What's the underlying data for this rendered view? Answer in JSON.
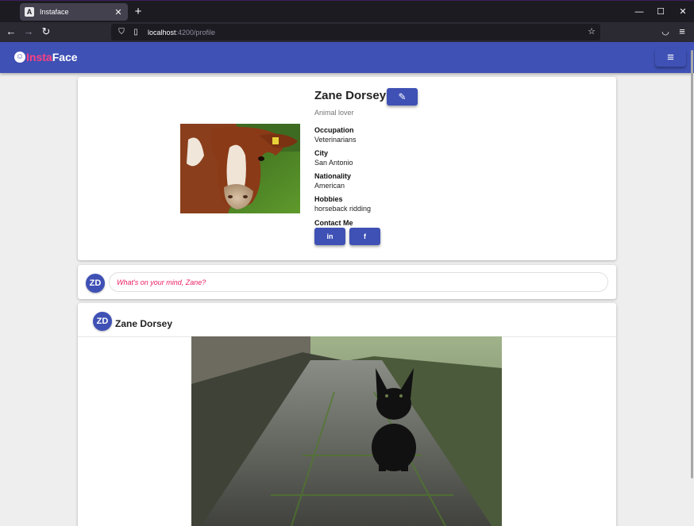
{
  "browser": {
    "tab_title": "Instaface",
    "tab_favicon": "A",
    "url_host": "localhost",
    "url_path": ":4200/profile",
    "icons": [
      "back-icon",
      "forward-icon",
      "reload-icon",
      "shield-icon",
      "page-icon",
      "star-icon",
      "pocket-icon",
      "menu-icon",
      "minimize-icon",
      "maximize-icon",
      "close-icon"
    ]
  },
  "app": {
    "brand_part1": "Insta",
    "brand_part2": "Face",
    "colors": {
      "primary": "#3f51b5",
      "accent": "#ff4081",
      "background": "#eeeeee"
    }
  },
  "profile": {
    "name": "Zane Dorsey",
    "bio": "Animal lover",
    "fields": [
      {
        "label": "Occupation",
        "value": "Veterinarians"
      },
      {
        "label": "City",
        "value": "San Antonio"
      },
      {
        "label": "Nationality",
        "value": "American"
      },
      {
        "label": "Hobbies",
        "value": "horseback ridding"
      }
    ],
    "contact_label": "Contact Me",
    "linkedin_label": "in",
    "facebook_label": "f"
  },
  "composer": {
    "avatar_initials": "ZD",
    "placeholder": "What's on your mind, Zane?"
  },
  "feed": {
    "posts": [
      {
        "avatar_initials": "ZD",
        "author": "Zane Dorsey"
      }
    ]
  }
}
